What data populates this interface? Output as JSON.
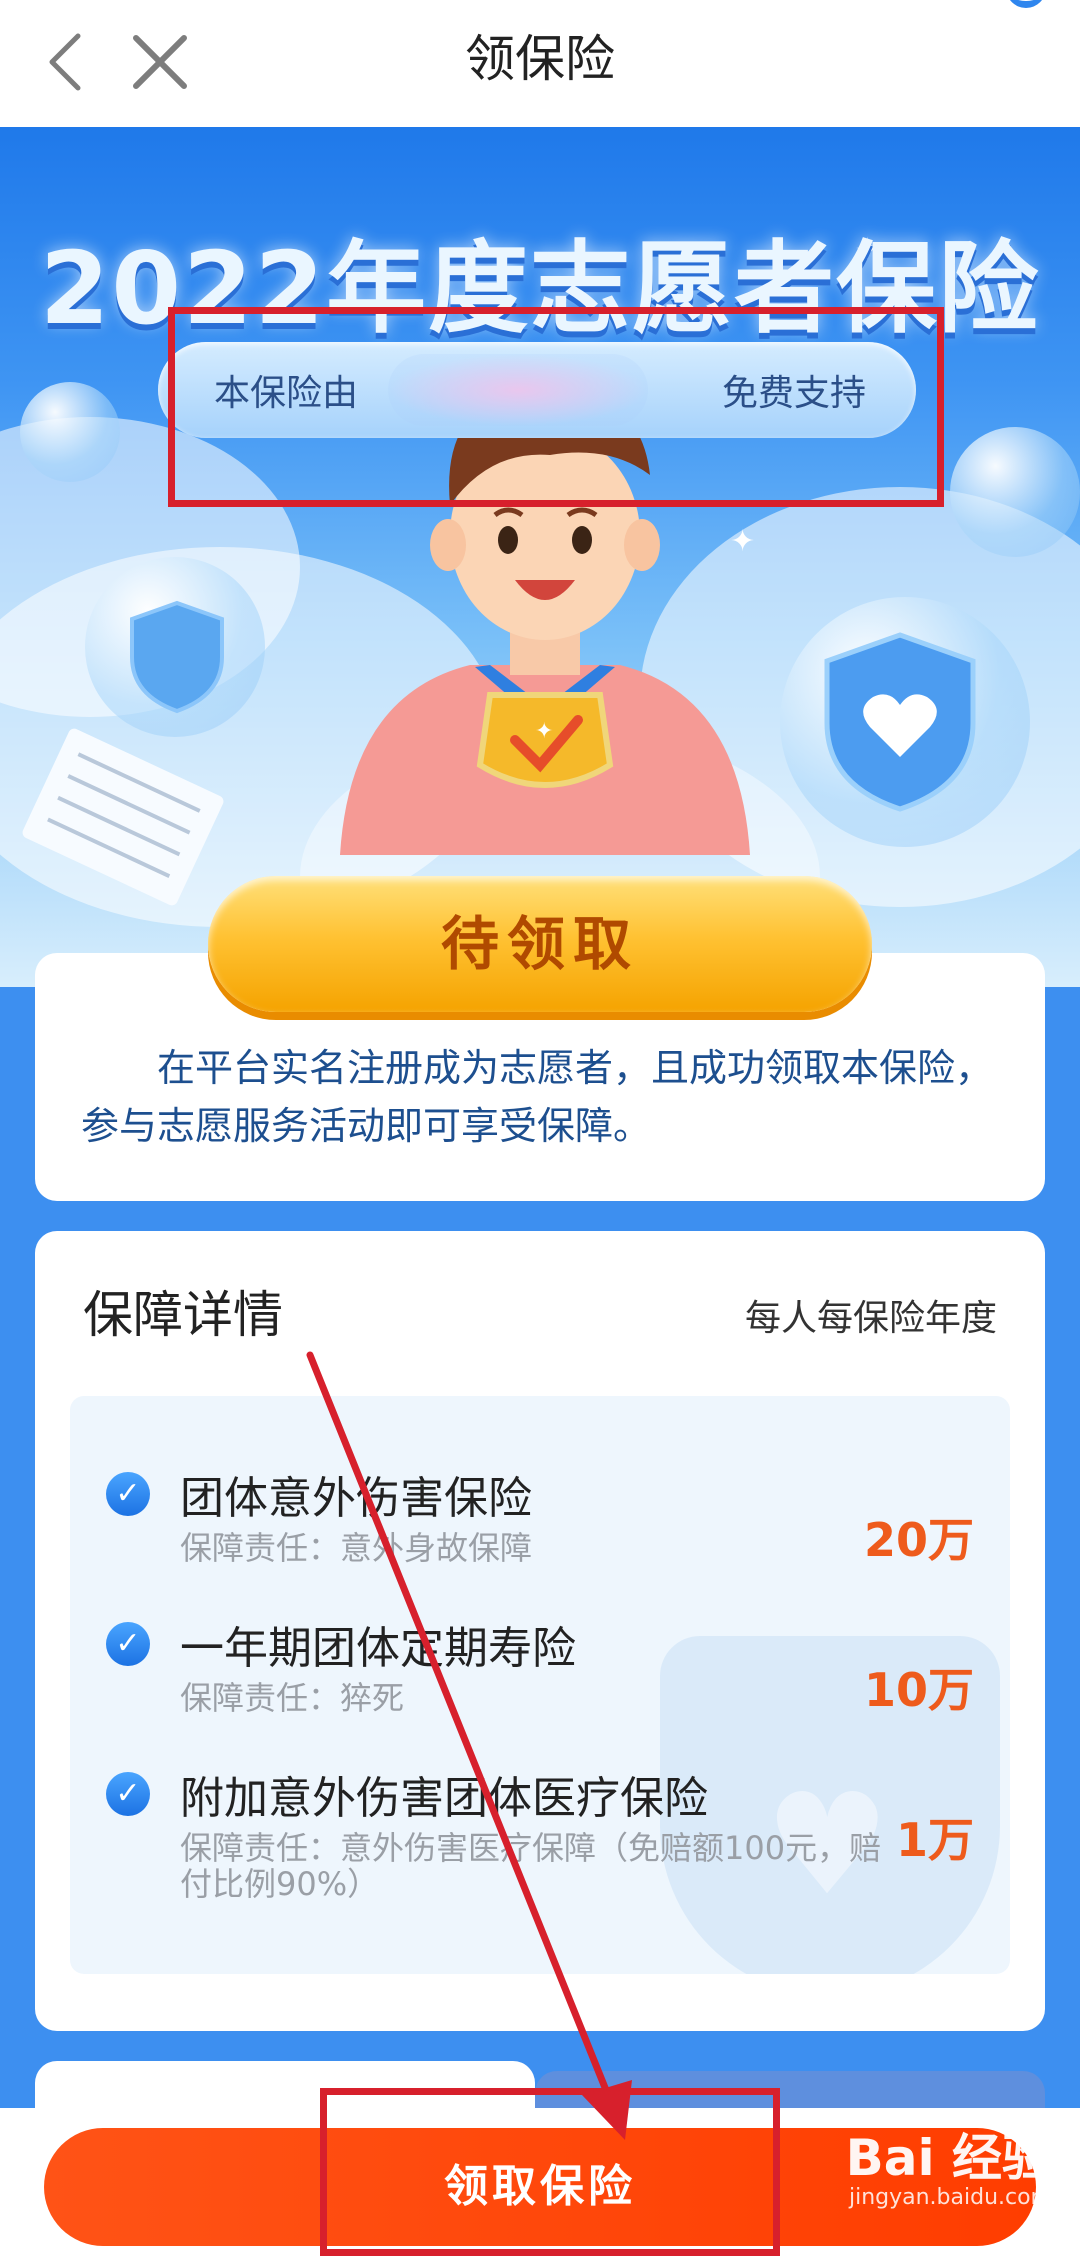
{
  "navbar": {
    "title": "领保险",
    "back_icon": "chevron-left-icon",
    "close_icon": "close-icon"
  },
  "hero": {
    "title": "2022年度志愿者保险",
    "sponsor_prefix": "本保险由",
    "sponsor_suffix": "免费支持"
  },
  "status_button": {
    "label": "待领取"
  },
  "intro": {
    "text": "在平台实名注册成为志愿者，且成功领取本保险，参与志愿服务活动即可享受保障。"
  },
  "details": {
    "title": "保障详情",
    "subtitle": "每人每保险年度",
    "items": [
      {
        "name": "团体意外伤害保险",
        "desc": "保障责任：意外身故保障",
        "amount": "20万"
      },
      {
        "name": "一年期团体定期寿险",
        "desc": "保障责任：猝死",
        "amount": "10万"
      },
      {
        "name": "附加意外伤害团体医疗保险",
        "desc": "保障责任：意外伤害医疗保障（免赔额100元，赔付比例90%）",
        "amount": "1万"
      }
    ]
  },
  "bottom": {
    "button_label": "领取保险"
  },
  "watermark": {
    "logo": "Bai 经验",
    "url": "jingyan.baidu.com"
  },
  "colors": {
    "primary_blue": "#2f86ee",
    "orange_button": "#ff4a0c",
    "amount_orange": "#ee5b1c",
    "annotation_red": "#d7202c",
    "gold_button": "#ffc233"
  }
}
